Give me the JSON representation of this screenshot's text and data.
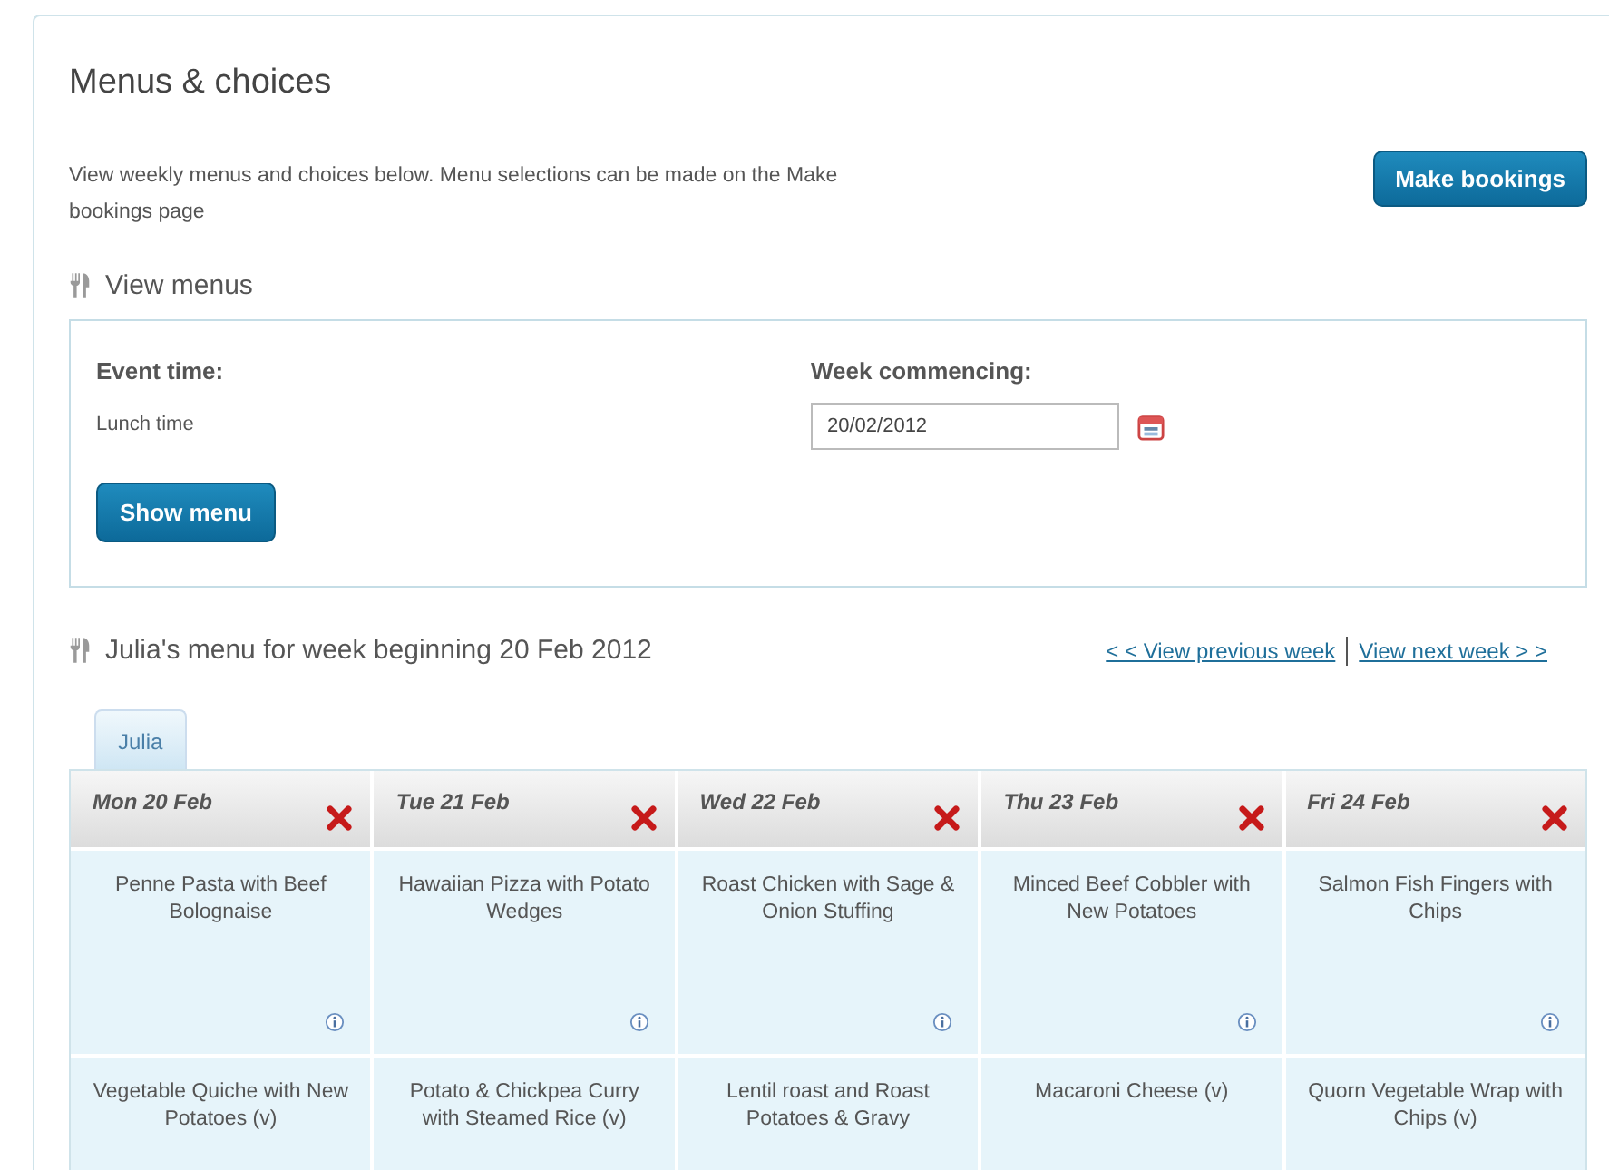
{
  "page_title": "Menus & choices",
  "intro": "View weekly menus and choices below. Menu selections can be made on the Make bookings page",
  "make_bookings_button": "Make bookings",
  "view_menus": {
    "heading": "View menus",
    "event_time_label": "Event time:",
    "event_time_value": "Lunch time",
    "week_label": "Week commencing:",
    "week_value": "20/02/2012",
    "show_button": "Show menu"
  },
  "menu": {
    "heading": "Julia's menu for week beginning 20 Feb 2012",
    "prev_link": "< < View previous week",
    "next_link": "View next week > >",
    "tabs": [
      {
        "label": "Julia",
        "selected": true
      }
    ],
    "days": [
      "Mon 20 Feb",
      "Tue 21 Feb",
      "Wed 22 Feb",
      "Thu 23 Feb",
      "Fri 24 Feb"
    ],
    "rows": [
      {
        "cells": [
          "Penne Pasta with Beef Bolognaise",
          "Hawaiian Pizza with Potato Wedges",
          "Roast Chicken with Sage & Onion Stuffing",
          "Minced Beef Cobbler with New Potatoes",
          "Salmon Fish Fingers with Chips"
        ]
      },
      {
        "cells": [
          "Vegetable Quiche with New Potatoes (v)",
          "Potato & Chickpea Curry with Steamed Rice (v)",
          "Lentil roast and Roast Potatoes & Gravy",
          "Macaroni Cheese (v)",
          "Quorn Vegetable Wrap with Chips (v)"
        ]
      }
    ]
  }
}
